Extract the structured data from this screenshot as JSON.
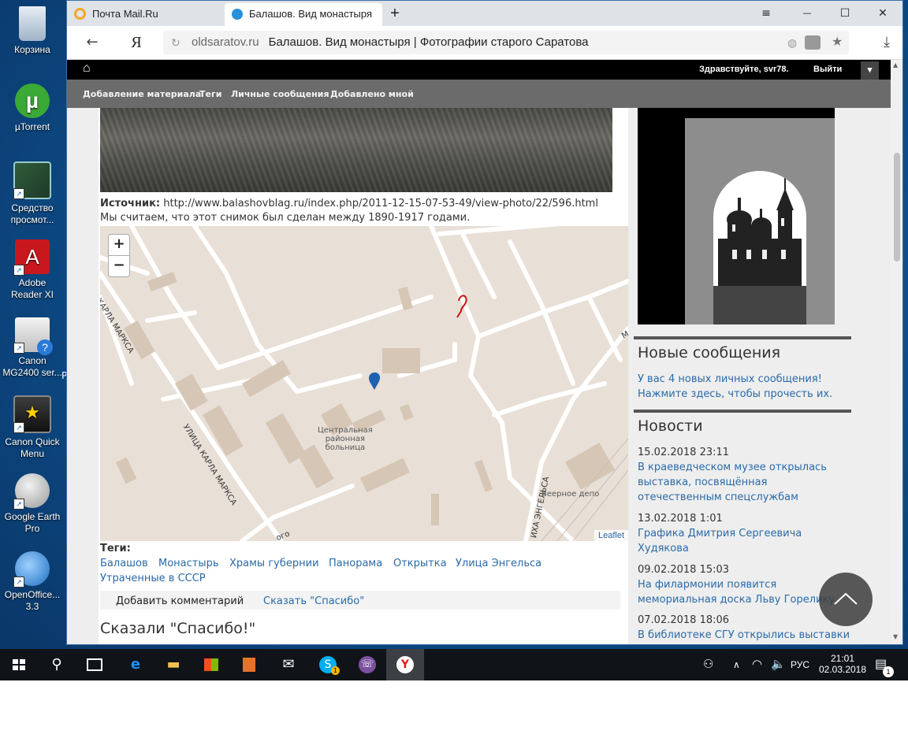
{
  "desktop": {
    "icons": [
      {
        "name": "recycle-bin",
        "label1": "Корзина",
        "label2": ""
      },
      {
        "name": "utorrent",
        "label1": "µTorrent",
        "label2": ""
      },
      {
        "name": "viewer",
        "label1": "Средство",
        "label2": "просмот..."
      },
      {
        "name": "adobe-reader",
        "label1": "Adobe",
        "label2": "Reader XI"
      },
      {
        "name": "canon-mg",
        "label1": "Canon",
        "label2": "MG2400 ser..."
      },
      {
        "name": "canon-quick",
        "label1": "Canon Quick",
        "label2": "Menu"
      },
      {
        "name": "google-earth",
        "label1": "Google Earth",
        "label2": "Pro"
      },
      {
        "name": "openoffice",
        "label1": "OpenOffice...",
        "label2": "3.3"
      }
    ],
    "clipped_char": "P"
  },
  "browser": {
    "tabs": [
      {
        "label": "Почта Mail.Ru",
        "color": "#f5a623"
      },
      {
        "label": "Балашов. Вид монастыря",
        "color": "#2b8fd6"
      }
    ],
    "new_tab": "+",
    "window_buttons": {
      "menu": "≡",
      "minimize": "—",
      "maximize": "☐",
      "close": "✕"
    },
    "address": {
      "yandex": "Я",
      "host": "oldsaratov.ru",
      "title": "Балашов. Вид монастыря | Фотографии старого Саратова"
    }
  },
  "site": {
    "home_icon": "⌂",
    "greeting": "Здравствуйте,",
    "user": "svr78.",
    "logout": "Выйти",
    "dropdown": "▾",
    "subnav": [
      "Добавление материала",
      "Теги",
      "Личные сообщения",
      "Добавлено мной"
    ],
    "source_label": "Источник:",
    "source_url": "http://www.balashovblag.ru/index.php/2011-12-15-07-53-49/view-photo/22/596.html",
    "date_note": "Мы считаем, что этот снимок был сделан между 1890-1917 годами.",
    "map": {
      "zoom_in": "+",
      "zoom_out": "−",
      "streets": [
        "КАРЛА МАРКСА",
        "УЛИЦА КАРЛА МАРКСА",
        "ИХА ЭНГЕЛЬСА",
        "ого",
        "М"
      ],
      "hospital": [
        "Центральная",
        "районная",
        "больница"
      ],
      "depot": "Веерное депо",
      "attribution": "Leaflet"
    },
    "tags_label": "Теги:",
    "tags_row1": [
      "Балашов",
      "Монастырь",
      "Храмы губернии",
      "Панорама",
      "Открытка",
      "Улица Энгельса"
    ],
    "tags_row2": [
      "Утраченные в СССР"
    ],
    "add_comment": "Добавить комментарий",
    "say_thanks": "Сказать \"Спасибо\"",
    "thanks_heading": "Сказали \"Спасибо!\"",
    "sidebar": {
      "new_messages_title": "Новые сообщения",
      "new_messages_line1": "У вас 4 новых личных сообщения!",
      "new_messages_line2": "Нажмите здесь, чтобы прочесть их.",
      "news_title": "Новости",
      "news": [
        {
          "date": "15.02.2018 23:11",
          "lines": [
            "В краеведческом музее открылась",
            "выставка, посвящённая",
            "отечественным спецслужбам"
          ]
        },
        {
          "date": "13.02.2018 1:01",
          "lines": [
            "Графика Дмитрия Сергеевича",
            "Худякова"
          ]
        },
        {
          "date": "09.02.2018 15:03",
          "lines": [
            "На филармонии появится",
            "мемориальная доска Льву Горелику"
          ]
        },
        {
          "date": "07.02.2018 18:06",
          "lines": [
            "В библиотеке СГУ открылись выставки"
          ]
        }
      ]
    }
  },
  "taskbar": {
    "lang": "РУС",
    "time": "21:01",
    "date": "02.03.2018",
    "notify_count": "1",
    "skype_badge": "1"
  }
}
